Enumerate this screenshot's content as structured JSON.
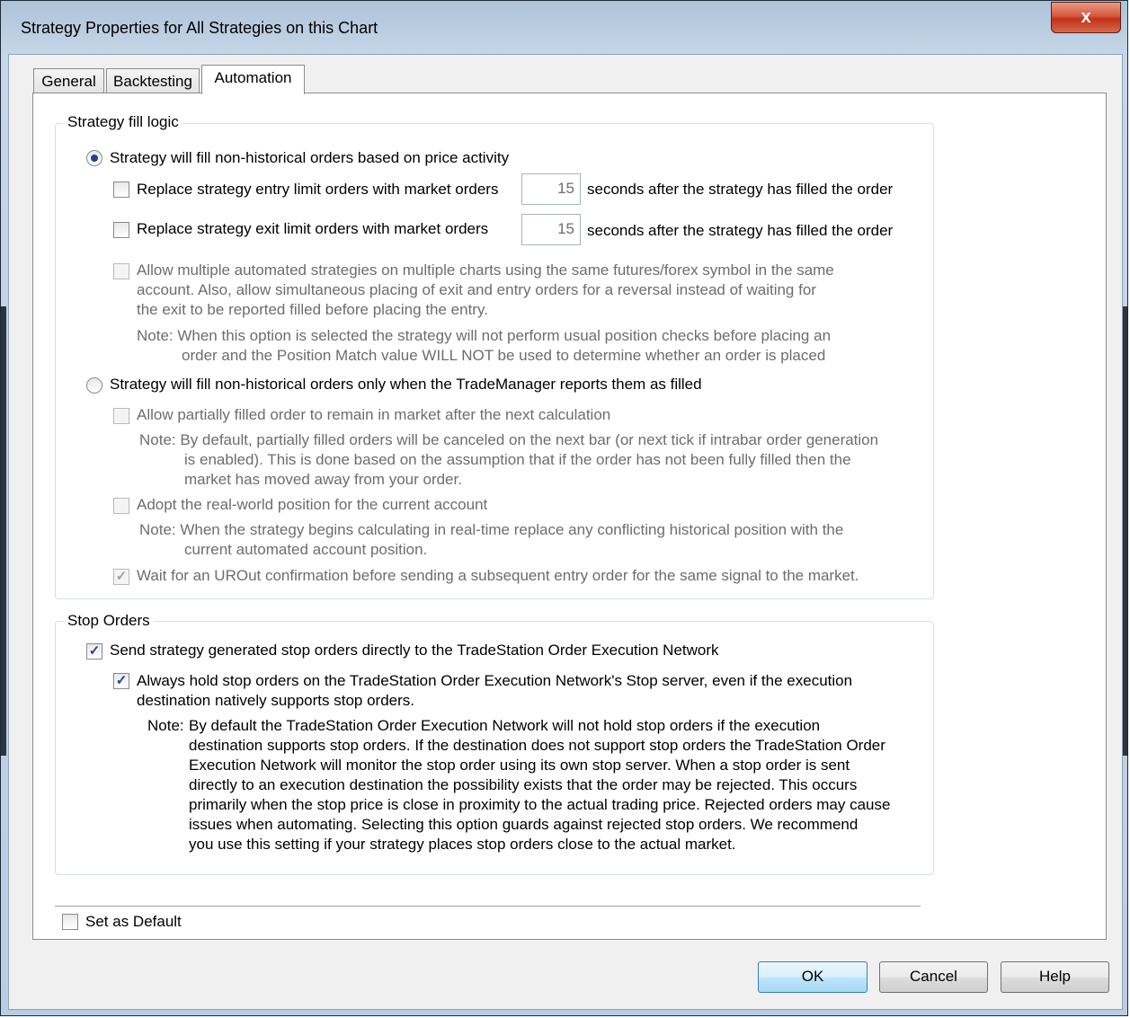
{
  "window": {
    "title": "Strategy Properties for All Strategies on this Chart",
    "close_label": "x"
  },
  "tabs": [
    {
      "label": "General",
      "active": false
    },
    {
      "label": "Backtesting",
      "active": false
    },
    {
      "label": "Automation",
      "active": true
    }
  ],
  "fill_logic": {
    "legend": "Strategy fill logic",
    "option_price_activity": {
      "label": "Strategy will fill non-historical orders based on price activity",
      "selected": true
    },
    "replace_entry": {
      "label": "Replace strategy entry limit orders with market orders",
      "checked": false,
      "seconds": "15",
      "suffix": "seconds after the strategy has filled the order"
    },
    "replace_exit": {
      "label": "Replace strategy exit limit orders with market orders",
      "checked": false,
      "seconds": "15",
      "suffix": "seconds after the strategy has filled the order"
    },
    "allow_multiple": {
      "line1": "Allow multiple automated strategies on multiple charts using the same futures/forex symbol in the same",
      "line2": "account.  Also, allow simultaneous placing of exit and entry orders for a reversal instead of waiting for",
      "line3": "the exit to be reported filled before placing the entry.",
      "checked": false,
      "note_line1": "Note: When this option is selected the strategy will not perform usual position checks before placing an",
      "note_line2": "order and the Position Match value WILL NOT be used to determine whether an order is placed"
    },
    "option_trademanager": {
      "label": "Strategy will fill non-historical orders only when the TradeManager reports them as filled",
      "selected": false
    },
    "partial_fill": {
      "label": "Allow partially filled order to remain in market after the next calculation",
      "checked": false,
      "note_line1": "Note: By default, partially filled orders will be canceled on the next bar (or next tick if intrabar order generation",
      "note_line2": "is enabled).  This is done based on the assumption that if the order has not been fully filled then the",
      "note_line3": "market has moved away from your order."
    },
    "adopt_position": {
      "label": "Adopt the real-world position for the current account",
      "checked": false,
      "note_line1": "Note: When the strategy begins calculating in real-time replace any conflicting historical position with the",
      "note_line2": "current automated account position."
    },
    "wait_urout": {
      "label": "Wait for an UROut confirmation before sending a subsequent entry order for the same signal to the market.",
      "checked": true
    }
  },
  "stop_orders": {
    "legend": "Stop Orders",
    "send_direct": {
      "label": "Send strategy generated stop orders directly to the TradeStation Order Execution Network",
      "checked": true
    },
    "always_hold": {
      "line1": "Always hold stop orders on the TradeStation Order Execution Network's Stop server, even if the execution",
      "line2": "destination natively supports stop orders.",
      "checked": true
    },
    "note": {
      "prefix": "Note:",
      "line1": "By default the TradeStation Order Execution Network will not hold stop orders if the execution",
      "line2": "destination supports stop orders.  If the destination does not support stop orders the TradeStation Order",
      "line3": "Execution Network will monitor the stop order using its own stop server.  When a stop order is sent",
      "line4": "directly to an execution destination the possibility exists that the order may be rejected.  This occurs",
      "line5": "primarily when the stop price is close in proximity to the actual trading price.  Rejected orders may cause",
      "line6": "issues when automating.  Selecting this option guards against rejected stop orders.  We recommend",
      "line7": "you use this setting if your strategy places stop orders close to the actual market."
    }
  },
  "set_default": {
    "label": "Set as Default",
    "checked": false
  },
  "buttons": {
    "ok": "OK",
    "cancel": "Cancel",
    "help": "Help"
  },
  "marks": {
    "check": "✓"
  }
}
